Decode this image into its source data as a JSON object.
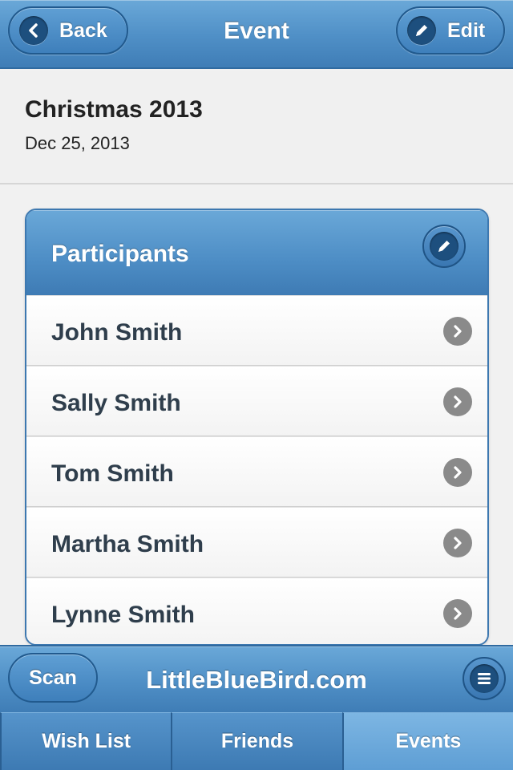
{
  "header": {
    "title": "Event",
    "back_label": "Back",
    "edit_label": "Edit"
  },
  "event": {
    "name": "Christmas 2013",
    "date": "Dec 25, 2013"
  },
  "participants": {
    "title": "Participants",
    "items": [
      {
        "label": "John Smith"
      },
      {
        "label": "Sally Smith"
      },
      {
        "label": "Tom Smith"
      },
      {
        "label": "Martha Smith"
      },
      {
        "label": "Lynne Smith"
      }
    ]
  },
  "footer": {
    "title": "LittleBlueBird.com",
    "scan_label": "Scan"
  },
  "tabs": [
    {
      "label": "Wish List",
      "active": false
    },
    {
      "label": "Friends",
      "active": false
    },
    {
      "label": "Events",
      "active": true
    }
  ],
  "icons": {
    "back": "chevron-left-icon",
    "edit": "pencil-icon",
    "row": "chevron-right-icon",
    "menu": "menu-icon"
  }
}
